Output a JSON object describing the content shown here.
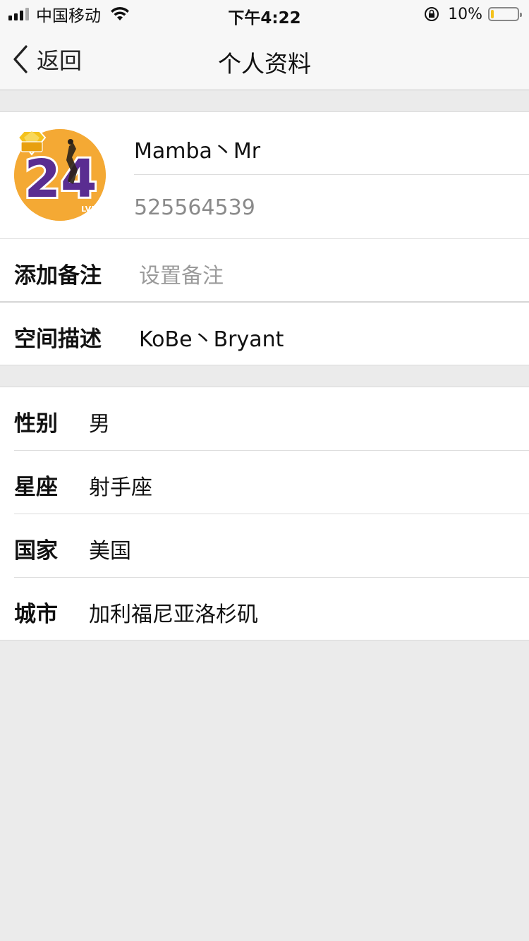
{
  "status_bar": {
    "carrier": "中国移动",
    "time": "下午4:22",
    "battery_percent": "10%",
    "battery_level": 0.1,
    "icons": [
      "signal-icon",
      "wifi-icon",
      "orientation-lock-icon",
      "battery-icon"
    ]
  },
  "nav": {
    "back_label": "返回",
    "title": "个人资料"
  },
  "profile": {
    "name": "Mamba丶Mr",
    "qq_number": "525564539",
    "avatar_text": "24",
    "level_badge": "LV5"
  },
  "remark_row": {
    "label": "添加备注",
    "placeholder": "设置备注"
  },
  "space_row": {
    "label": "空间描述",
    "value": "KoBe丶Bryant"
  },
  "info": [
    {
      "label": "性别",
      "value": "男"
    },
    {
      "label": "星座",
      "value": "射手座"
    },
    {
      "label": "国家",
      "value": "美国"
    },
    {
      "label": "城市",
      "value": "加利福尼亚洛杉矶"
    }
  ],
  "colors": {
    "avatar_bg": "#f4a934",
    "avatar_digits": "#5a2d91",
    "badge": "#f4c21d",
    "background": "#ebebeb"
  }
}
